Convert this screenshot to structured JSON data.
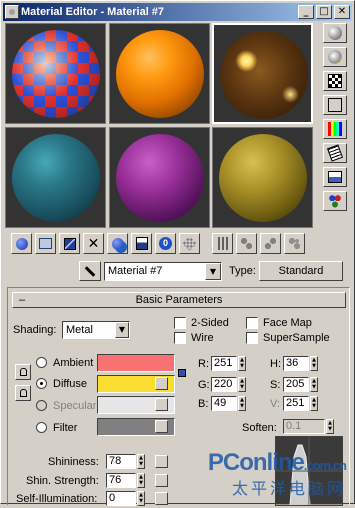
{
  "window": {
    "title": "Material Editor - Material #7",
    "buttons": [
      "_",
      "□",
      "✕"
    ]
  },
  "slots": [
    {
      "name": "checker-ball"
    },
    {
      "name": "orange-ball"
    },
    {
      "name": "brown-glossy-ball",
      "active": true
    },
    {
      "name": "teal-ball"
    },
    {
      "name": "purple-ball"
    },
    {
      "name": "gold-ball"
    }
  ],
  "side_tools": [
    "sample-type-icon",
    "backlight-icon",
    "background-checker-icon",
    "sample-uv-tiling-icon",
    "video-color-check-icon",
    "make-preview-icon",
    "options-icon",
    "select-by-material-icon"
  ],
  "bottom_tools": [
    "get-material-icon",
    "put-to-scene-icon",
    "assign-to-selection-icon",
    "reset-map-icon",
    "make-copy-icon",
    "put-to-library-icon",
    "material-effects-channel-icon",
    "show-map-in-viewport-icon",
    "show-end-result-icon",
    "go-to-parent-icon",
    "go-forward-icon",
    "material-map-navigator-icon"
  ],
  "name_bar": {
    "material_name": "Material #7",
    "type_label": "Type:",
    "type_value": "Standard"
  },
  "basic_params": {
    "header": "Basic Parameters",
    "collapse": "–",
    "shading_label": "Shading:",
    "shading_value": "Metal",
    "two_sided": "2-Sided",
    "wire": "Wire",
    "face_map": "Face Map",
    "super_sample": "SuperSample",
    "ambient": "Ambient",
    "diffuse": "Diffuse",
    "specular": "Specular",
    "filter": "Filter",
    "colors": {
      "ambient": "#f87272",
      "diffuse": "#fbdc31",
      "specular": "#e6e6e6",
      "filter": "#808080"
    },
    "r_label": "R:",
    "g_label": "G:",
    "b_label": "B:",
    "h_label": "H:",
    "s_label": "S:",
    "v_label": "V:",
    "r": "251",
    "g": "220",
    "b": "49",
    "h": "36",
    "s": "205",
    "v": "251",
    "soften_label": "Soften:",
    "soften_value": "0.1",
    "shininess_label": "Shininess:",
    "shininess_value": "78",
    "shin_strength_label": "Shin. Strength:",
    "shin_strength_value": "76",
    "self_illum_label": "Self-Illumination:",
    "self_illum_value": "0"
  },
  "watermark": {
    "brand": "PConline",
    "domain": ".com.cn",
    "chinese": "太平洋电脑网"
  }
}
